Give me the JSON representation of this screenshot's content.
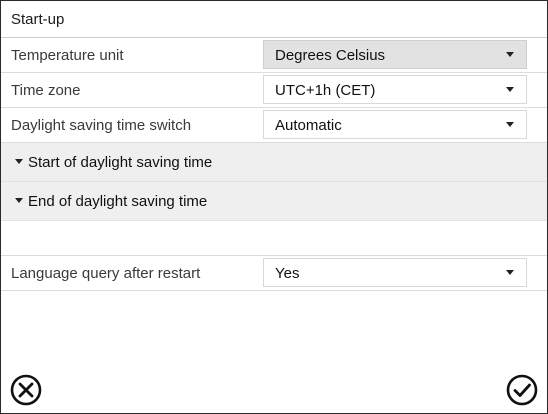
{
  "window": {
    "title": "Start-up"
  },
  "settings": {
    "temperature_unit": {
      "label": "Temperature unit",
      "value": "Degrees Celsius"
    },
    "time_zone": {
      "label": "Time zone",
      "value": "UTC+1h (CET)"
    },
    "daylight_saving": {
      "label": "Daylight saving time switch",
      "value": "Automatic"
    },
    "language_query": {
      "label": "Language query after restart",
      "value": "Yes"
    }
  },
  "sections": {
    "start_dst": {
      "label": "Start of daylight saving time"
    },
    "end_dst": {
      "label": "End of daylight saving time"
    }
  },
  "footer": {
    "cancel_icon": "close-circle-icon",
    "confirm_icon": "check-circle-icon"
  }
}
